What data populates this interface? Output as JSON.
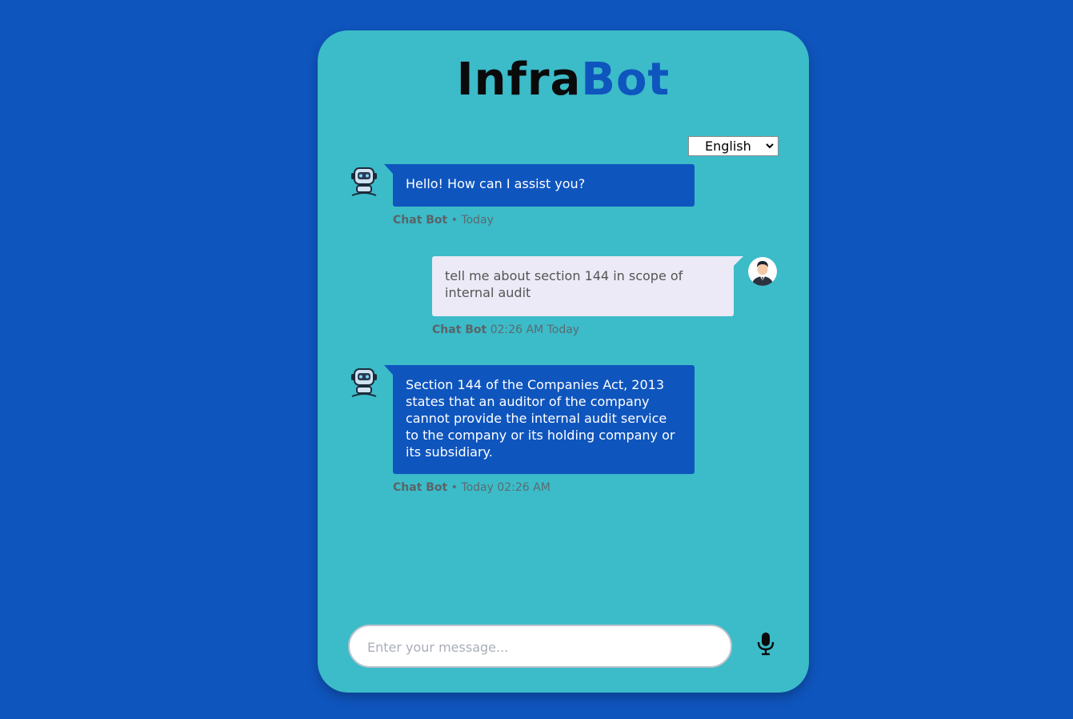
{
  "app": {
    "title_part1": "Infra",
    "title_part2": "Bot"
  },
  "language": {
    "selected": "English"
  },
  "messages": [
    {
      "sender": "bot",
      "text": "Hello! How can I assist you?",
      "meta_name": "Chat Bot",
      "meta_time": " • Today"
    },
    {
      "sender": "user",
      "text": "tell me about section 144 in scope of internal audit",
      "meta_name": "Chat Bot",
      "meta_time": " 02:26 AM Today"
    },
    {
      "sender": "bot",
      "text": "Section 144 of the Companies Act, 2013 states that an auditor of the company cannot provide the internal audit service to the company or its holding company or its subsidiary.",
      "meta_name": "Chat Bot",
      "meta_time": " • Today 02:26 AM"
    }
  ],
  "composer": {
    "placeholder": "Enter your message...",
    "value": "",
    "mic_icon": "microphone-icon"
  },
  "colors": {
    "background": "#0f55be",
    "card": "#3cbbc9",
    "bot_bubble": "#0f55be",
    "user_bubble": "#ebeaf6",
    "title_dark": "#0a0a0a",
    "title_accent": "#0f55be"
  }
}
